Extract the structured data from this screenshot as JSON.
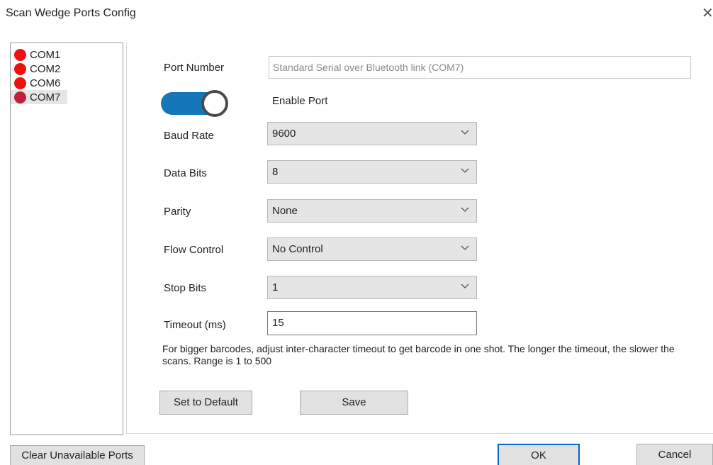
{
  "window": {
    "title": "Scan Wedge Ports Config",
    "close_glyph": "✕"
  },
  "ports": [
    {
      "label": "COM1",
      "status_color": "#f01010"
    },
    {
      "label": "COM2",
      "status_color": "#f01010"
    },
    {
      "label": "COM6",
      "status_color": "#f01010"
    },
    {
      "label": "COM7",
      "status_color": "#c0203c",
      "selected": true
    }
  ],
  "config": {
    "port_number_label": "Port Number",
    "port_number_value": "Standard Serial over Bluetooth link (COM7)",
    "enable_port_label": "Enable Port",
    "enable_port_on": true,
    "baud_rate_label": "Baud Rate",
    "baud_rate_value": "9600",
    "data_bits_label": "Data Bits",
    "data_bits_value": "8",
    "parity_label": "Parity",
    "parity_value": "None",
    "flow_control_label": "Flow Control",
    "flow_control_value": "No Control",
    "stop_bits_label": "Stop Bits",
    "stop_bits_value": "1",
    "timeout_label": "Timeout (ms)",
    "timeout_value": "15",
    "help_text": "For bigger barcodes, adjust inter-character timeout to get barcode in one shot. The longer the timeout, the slower the scans. Range is 1 to 500",
    "set_default_label": "Set to Default",
    "save_label": "Save"
  },
  "footer": {
    "clear_ports_label": "Clear Unavailable Ports",
    "ok_label": "OK",
    "cancel_label": "Cancel"
  },
  "colors": {
    "toggle_on": "#1577b8",
    "port_unavailable": "#f01010",
    "port_selected": "#c0203c",
    "default_button_border": "#0a64c8"
  }
}
